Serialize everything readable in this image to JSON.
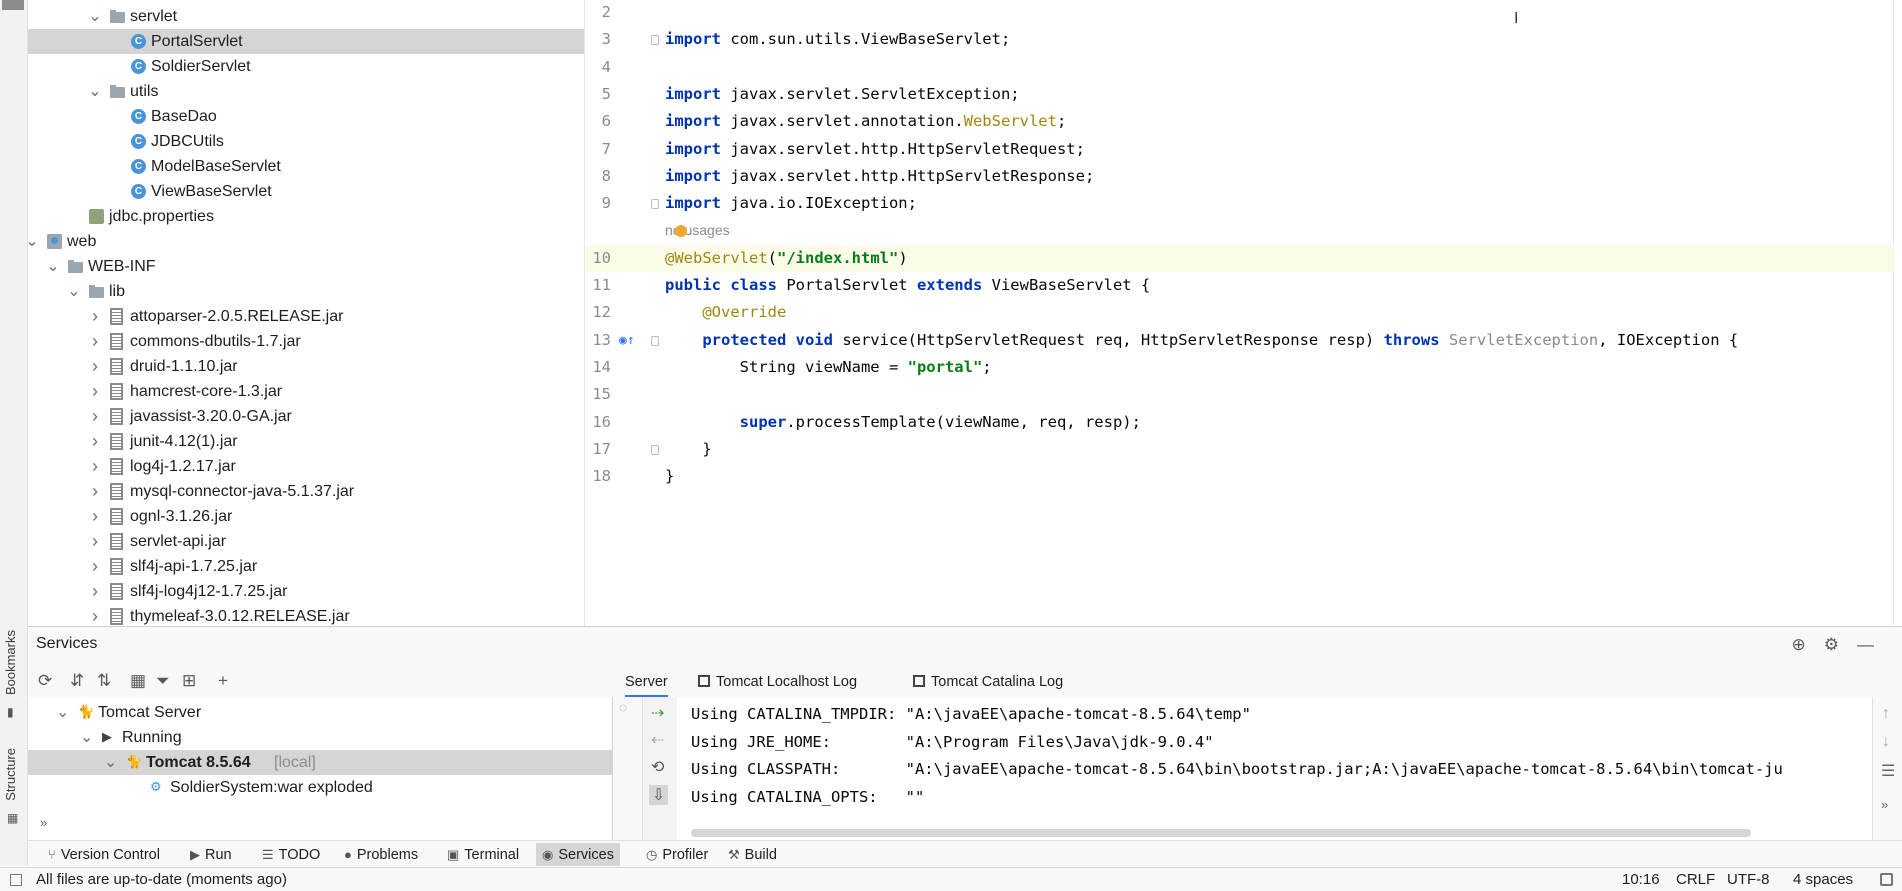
{
  "left_strip": {
    "bookmarks_label": "Bookmarks",
    "structure_label": "Structure"
  },
  "project_tree": [
    {
      "label": "servlet",
      "type": "folder",
      "depth": 4,
      "expanded": true
    },
    {
      "label": "PortalServlet",
      "type": "class",
      "depth": 5,
      "selected": true
    },
    {
      "label": "SoldierServlet",
      "type": "class",
      "depth": 5
    },
    {
      "label": "utils",
      "type": "folder",
      "depth": 4,
      "expanded": true
    },
    {
      "label": "BaseDao",
      "type": "class",
      "depth": 5
    },
    {
      "label": "JDBCUtils",
      "type": "class",
      "depth": 5
    },
    {
      "label": "ModelBaseServlet",
      "type": "class",
      "depth": 5
    },
    {
      "label": "ViewBaseServlet",
      "type": "class",
      "depth": 5
    },
    {
      "label": "jdbc.properties",
      "type": "props",
      "depth": 3
    },
    {
      "label": "web",
      "type": "web",
      "depth": 1,
      "expanded": true
    },
    {
      "label": "WEB-INF",
      "type": "folder",
      "depth": 2,
      "expanded": true
    },
    {
      "label": "lib",
      "type": "folder",
      "depth": 3,
      "expanded": true
    },
    {
      "label": "attoparser-2.0.5.RELEASE.jar",
      "type": "jar",
      "depth": 4
    },
    {
      "label": "commons-dbutils-1.7.jar",
      "type": "jar",
      "depth": 4
    },
    {
      "label": "druid-1.1.10.jar",
      "type": "jar",
      "depth": 4
    },
    {
      "label": "hamcrest-core-1.3.jar",
      "type": "jar",
      "depth": 4
    },
    {
      "label": "javassist-3.20.0-GA.jar",
      "type": "jar",
      "depth": 4
    },
    {
      "label": "junit-4.12(1).jar",
      "type": "jar",
      "depth": 4
    },
    {
      "label": "log4j-1.2.17.jar",
      "type": "jar",
      "depth": 4
    },
    {
      "label": "mysql-connector-java-5.1.37.jar",
      "type": "jar",
      "depth": 4
    },
    {
      "label": "ognl-3.1.26.jar",
      "type": "jar",
      "depth": 4
    },
    {
      "label": "servlet-api.jar",
      "type": "jar",
      "depth": 4
    },
    {
      "label": "slf4j-api-1.7.25.jar",
      "type": "jar",
      "depth": 4
    },
    {
      "label": "slf4j-log4j12-1.7.25.jar",
      "type": "jar",
      "depth": 4
    },
    {
      "label": "thymeleaf-3.0.12.RELEASE.jar",
      "type": "jar",
      "depth": 4
    }
  ],
  "editor": {
    "lines": [
      {
        "n": "2",
        "html": ""
      },
      {
        "n": "3",
        "html": "<span class=\"kw\">import</span> com.sun.utils.ViewBaseServlet;"
      },
      {
        "n": "4",
        "html": ""
      },
      {
        "n": "5",
        "html": "<span class=\"kw\">import</span> javax.servlet.ServletException;"
      },
      {
        "n": "6",
        "html": "<span class=\"kw\">import</span> javax.servlet.annotation.<span class=\"ann\">WebServlet</span>;"
      },
      {
        "n": "7",
        "html": "<span class=\"kw\">import</span> javax.servlet.http.HttpServletRequest;"
      },
      {
        "n": "8",
        "html": "<span class=\"kw\">import</span> javax.servlet.http.HttpServletResponse;"
      },
      {
        "n": "9",
        "html": "<span class=\"kw\">import</span> java.io.IOException;"
      },
      {
        "n": "",
        "html": "<span class=\"hint\">no usages</span>"
      },
      {
        "n": "10",
        "html": "<span class=\"ann\">@WebServlet</span>(<span class=\"str\">\"/index.html\"</span>)",
        "current": true
      },
      {
        "n": "11",
        "html": "<span class=\"kw\">public class</span> PortalServlet <span class=\"kw\">extends</span> ViewBaseServlet {"
      },
      {
        "n": "12",
        "html": "    <span class=\"ann\">@Override</span>"
      },
      {
        "n": "13",
        "html": "    <span class=\"kw\">protected void</span> service(HttpServletRequest req, HttpServletResponse resp) <span class=\"kw\">throws</span> <span class=\"cls-grey\">ServletException</span>, IOException {"
      },
      {
        "n": "14",
        "html": "        String viewName = <span class=\"str\">\"portal\"</span>;"
      },
      {
        "n": "15",
        "html": ""
      },
      {
        "n": "16",
        "html": "        <span class=\"kw\">super</span>.processTemplate(viewName, req, resp);"
      },
      {
        "n": "17",
        "html": "    }"
      },
      {
        "n": "18",
        "html": "}"
      }
    ]
  },
  "services": {
    "title": "Services",
    "tree": [
      {
        "label": "Tomcat Server",
        "depth": 0,
        "chev": "v",
        "icon": "tomcat"
      },
      {
        "label": "Running",
        "depth": 1,
        "chev": "v",
        "icon": "run"
      },
      {
        "label": "Tomcat 8.5.64",
        "suffix": "[local]",
        "depth": 2,
        "chev": "v",
        "icon": "tomcat",
        "selected": true,
        "bold": true
      },
      {
        "label": "SoldierSystem:war exploded",
        "depth": 3,
        "icon": "artifact"
      }
    ],
    "tabs": [
      "Server",
      "Tomcat Localhost Log",
      "Tomcat Catalina Log"
    ],
    "console": [
      "Using CATALINA_TMPDIR: \"A:\\javaEE\\apache-tomcat-8.5.64\\temp\"",
      "Using JRE_HOME:        \"A:\\Program Files\\Java\\jdk-9.0.4\"",
      "Using CLASSPATH:       \"A:\\javaEE\\apache-tomcat-8.5.64\\bin\\bootstrap.jar;A:\\javaEE\\apache-tomcat-8.5.64\\bin\\tomcat-ju",
      "Using CATALINA_OPTS:   \"\""
    ]
  },
  "tool_tabs": [
    {
      "label": "Version Control",
      "icon": "⑂"
    },
    {
      "label": "Run",
      "icon": "▶"
    },
    {
      "label": "TODO",
      "icon": "☰"
    },
    {
      "label": "Problems",
      "icon": "●"
    },
    {
      "label": "Terminal",
      "icon": "▣"
    },
    {
      "label": "Services",
      "icon": "◉",
      "active": true
    },
    {
      "label": "Profiler",
      "icon": "◷"
    },
    {
      "label": "Build",
      "icon": "⚒"
    }
  ],
  "status": {
    "message": "All files are up-to-date (moments ago)",
    "position": "10:16",
    "line_sep": "CRLF",
    "encoding": "UTF-8",
    "indent": "4 spaces"
  },
  "colors": {
    "selection": "#d5d5d5",
    "keyword": "#0033b3",
    "annotation": "#9e880d",
    "string": "#067d17",
    "current_line": "#fcfae8"
  }
}
